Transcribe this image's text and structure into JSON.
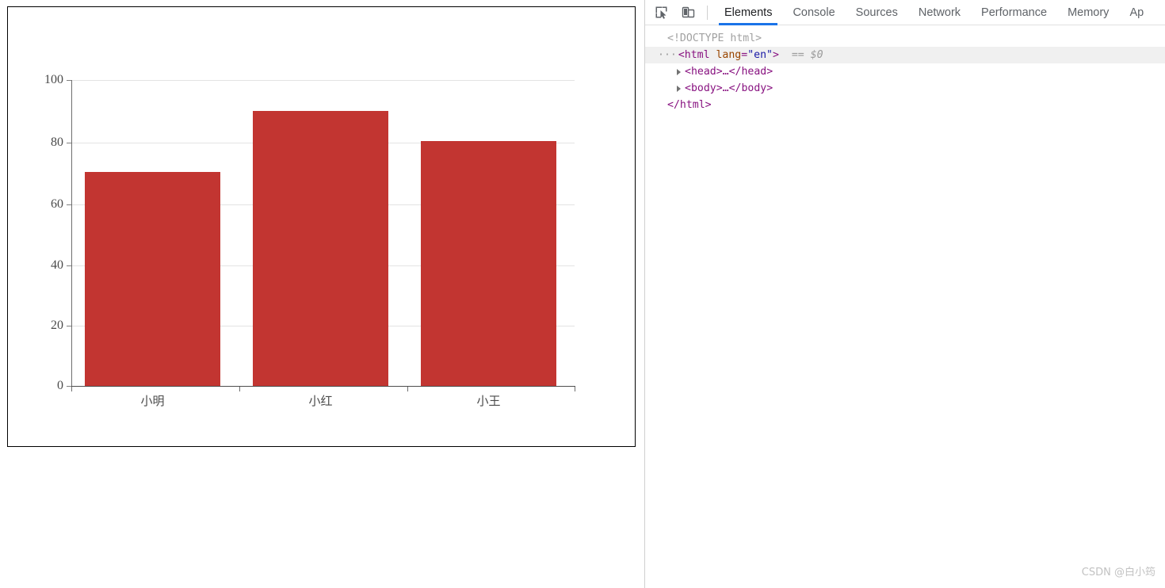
{
  "page": {
    "watermark": "CSDN @白小筠"
  },
  "chart_data": {
    "type": "bar",
    "title": "",
    "subtitle": "",
    "xlabel": "",
    "ylabel": "",
    "categories": [
      "小明",
      "小红",
      "小王"
    ],
    "values": [
      70,
      90,
      80
    ],
    "series": [
      {
        "name": "",
        "values": [
          70,
          90,
          80
        ]
      }
    ],
    "ylim": [
      0,
      100
    ],
    "yticks": [
      0,
      20,
      40,
      60,
      80,
      100
    ],
    "ytick_labels": [
      "0",
      "20",
      "40",
      "60",
      "80",
      "100"
    ],
    "grid": true,
    "legend": "none",
    "bar_color": "#c23531",
    "gridline_color": "#e3e3e3",
    "axis_color": "#6e6e6e"
  },
  "devtools": {
    "icons": {
      "inspect": "inspect-element-icon",
      "device": "device-toolbar-icon"
    },
    "tabs": [
      {
        "label": "Elements",
        "active": true
      },
      {
        "label": "Console",
        "active": false
      },
      {
        "label": "Sources",
        "active": false
      },
      {
        "label": "Network",
        "active": false
      },
      {
        "label": "Performance",
        "active": false
      },
      {
        "label": "Memory",
        "active": false
      },
      {
        "label": "Ap",
        "active": false
      }
    ],
    "dom": {
      "doctype": "<!DOCTYPE html>",
      "html_open_tag": "<html",
      "html_attr_name": "lang",
      "html_attr_value": "\"en\"",
      "html_open_close": ">",
      "selected_marker": "== $0",
      "head_row": "<head>…</head>",
      "body_row": "<body>…</body>",
      "html_close_tag": "</html>"
    }
  }
}
